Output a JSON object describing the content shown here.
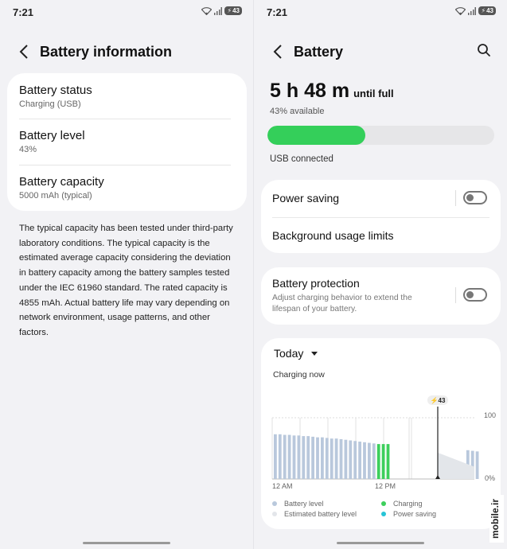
{
  "status_bar": {
    "time": "7:21",
    "battery_pct": "43",
    "wifi_icon": "wifi-icon",
    "signal_icon": "signal-icon",
    "battery_icon": "battery-charging-icon"
  },
  "left_screen": {
    "title": "Battery information",
    "rows": [
      {
        "label": "Battery status",
        "value": "Charging (USB)"
      },
      {
        "label": "Battery level",
        "value": "43%"
      },
      {
        "label": "Battery capacity",
        "value": "5000 mAh (typical)"
      }
    ],
    "description": "The typical capacity has been tested under third-party laboratory conditions. The typical capacity is the estimated average capacity considering the deviation in battery capacity among the battery samples tested under the IEC 61960 standard. The rated capacity is 4855 mAh. Actual battery life may vary depending on network environment, usage patterns, and other factors."
  },
  "right_screen": {
    "title": "Battery",
    "time_big": "5 h 48 m",
    "time_suffix": "until full",
    "available": "43% available",
    "level_percent": 43,
    "connection": "USB connected",
    "power_saving": {
      "label": "Power saving",
      "enabled": false
    },
    "background_limits": {
      "label": "Background usage limits"
    },
    "battery_protection": {
      "label": "Battery protection",
      "description": "Adjust charging behavior to extend the lifespan of your battery.",
      "enabled": false
    },
    "usage": {
      "period": "Today",
      "status": "Charging now",
      "marker_label": "43",
      "legend": [
        {
          "label": "Battery level",
          "color": "#b9c8dc"
        },
        {
          "label": "Charging",
          "color": "#3dcf5c"
        },
        {
          "label": "Estimated battery level",
          "color": "#e3e6ea"
        },
        {
          "label": "Power saving",
          "color": "#27c4d6"
        }
      ]
    }
  },
  "chart_data": {
    "type": "bar",
    "title": "Today",
    "x_ticks": [
      "12 AM",
      "12 PM"
    ],
    "y_ticks": [
      "100",
      "0%"
    ],
    "ylim": [
      0,
      100
    ],
    "series": [
      {
        "name": "Battery level",
        "values": [
          73,
          73,
          72,
          72,
          71,
          71,
          70,
          70,
          69,
          68,
          68,
          67,
          66,
          66,
          65,
          64,
          63,
          62,
          61,
          60,
          59,
          58,
          0,
          0,
          0,
          0,
          0,
          0,
          0,
          0,
          0,
          0,
          0,
          0,
          0,
          0,
          0,
          0,
          0,
          0,
          0,
          47,
          46,
          45
        ]
      },
      {
        "name": "Charging",
        "values": [
          0,
          0,
          0,
          0,
          0,
          0,
          0,
          0,
          0,
          0,
          0,
          0,
          0,
          0,
          0,
          0,
          0,
          0,
          0,
          0,
          0,
          0,
          57,
          57,
          57,
          0,
          0,
          0,
          0,
          0,
          0,
          0,
          0,
          0,
          0,
          0,
          0,
          0,
          0,
          0,
          0,
          0,
          0,
          0
        ]
      }
    ],
    "estimated": {
      "from": 43,
      "to": 20
    },
    "current_marker": 43
  }
}
